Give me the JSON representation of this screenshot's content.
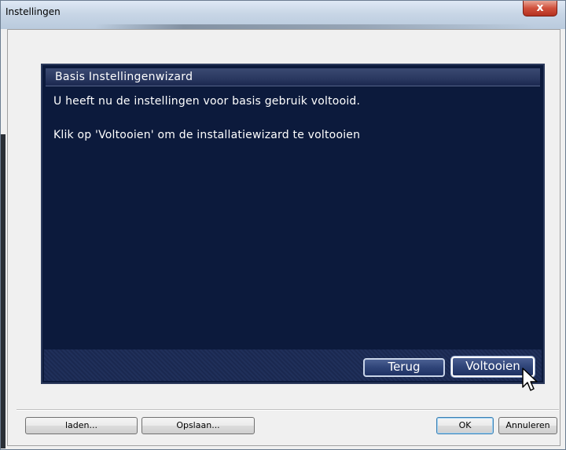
{
  "window": {
    "title": "Instellingen",
    "close_glyph": "x"
  },
  "wizard": {
    "header": "Basis Instellingenwizard",
    "line1": "U heeft nu de instellingen voor basis gebruik voltooid.",
    "line2": "Klik op 'Voltooien' om de installatiewizard te voltooien",
    "back_label": "Terug",
    "finish_label": "Voltooien"
  },
  "bottom_buttons": {
    "load_label": "laden...",
    "save_label": "Opslaan...",
    "ok_label": "OK",
    "cancel_label": "Annuleren"
  },
  "icons": {
    "close": "close-icon",
    "cursor": "mouse-cursor-icon"
  },
  "colors": {
    "panel_bg": "#0c1a3c",
    "header_bg": "#2a3860",
    "close_red": "#c8402c"
  }
}
